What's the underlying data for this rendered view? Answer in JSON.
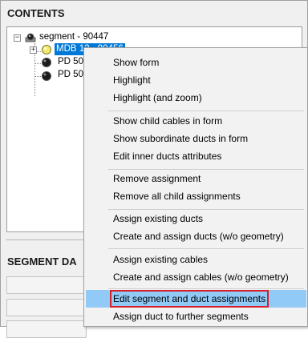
{
  "sections": {
    "contents_title": "CONTENTS",
    "segment_data_title": "SEGMENT DA"
  },
  "tree": {
    "root": {
      "label": "segment - 90447",
      "icon": "segment-icon"
    },
    "children": [
      {
        "label": "MDB 12 - 90456",
        "icon": "yellow-circle-icon",
        "selected": true
      },
      {
        "label": "PD 50_",
        "icon": "black-circle-icon"
      },
      {
        "label": "PD 50_",
        "icon": "black-circle-icon"
      }
    ]
  },
  "context_menu": {
    "groups": [
      [
        "Show form",
        "Highlight",
        "Highlight (and zoom)"
      ],
      [
        "Show child cables in form",
        "Show subordinate ducts in form",
        "Edit inner ducts attributes"
      ],
      [
        "Remove assignment",
        "Remove all child assignments"
      ],
      [
        "Assign existing ducts",
        "Create and assign ducts (w/o geometry)"
      ],
      [
        "Assign existing cables",
        "Create and assign cables (w/o geometry)"
      ],
      [
        "Edit segment and duct assignments",
        "Assign duct to further segments"
      ]
    ],
    "highlighted_item": "Edit segment and duct assignments",
    "highlight_color": "#91c9f7",
    "highlight_border_color": "#d61f26"
  },
  "colors": {
    "selection": "#0078d7",
    "panel_background": "#f0f0f0"
  }
}
